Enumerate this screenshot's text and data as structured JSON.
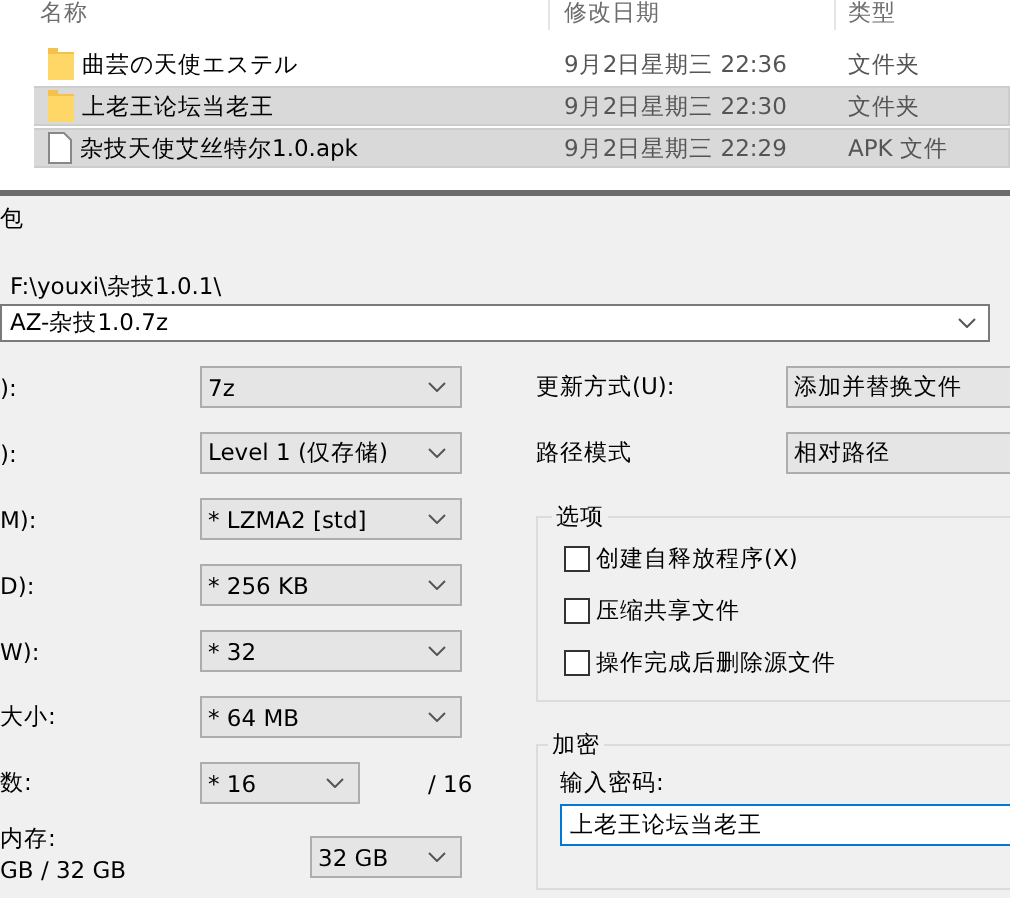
{
  "file_list": {
    "columns": [
      "名称",
      "修改日期",
      "类型"
    ],
    "rows": [
      {
        "kind": "folder",
        "name": "曲芸の天使エステル",
        "date": "9月2日星期三 22:36",
        "type": "文件夹",
        "selected": false
      },
      {
        "kind": "folder",
        "name": "上老王论坛当老王",
        "date": "9月2日星期三 22:30",
        "type": "文件夹",
        "selected": true
      },
      {
        "kind": "file",
        "name": "杂技天使艾丝特尔1.0.apk",
        "date": "9月2日星期三 22:29",
        "type": "APK 文件",
        "selected": true
      }
    ]
  },
  "dialog": {
    "title": "包",
    "archive_path": "F:\\youxi\\杂技1.0.1\\",
    "archive_name": "AZ-杂技1.0.7z",
    "settings": [
      {
        "kind": "select",
        "label": "):",
        "value": "7z"
      },
      {
        "kind": "select",
        "label": "):",
        "value": "Level 1 (仅存储)"
      },
      {
        "kind": "select",
        "label": "M):",
        "value": "* LZMA2 [std]"
      },
      {
        "kind": "select",
        "label": "D):",
        "value": "* 256 KB"
      },
      {
        "kind": "select",
        "label": "W):",
        "value": "* 32"
      },
      {
        "kind": "select",
        "label": "大小:",
        "value": "* 64 MB"
      },
      {
        "kind": "threads",
        "label": "数:",
        "value": "* 16",
        "suffix": "/ 16"
      },
      {
        "kind": "memory",
        "label": "内存:",
        "sublabel": "GB / 32 GB",
        "value": "32 GB"
      }
    ],
    "update_mode": {
      "label": "更新方式(U):",
      "value": "添加并替换文件"
    },
    "path_mode": {
      "label": "路径模式",
      "value": "相对路径"
    },
    "options": {
      "title": "选项",
      "items": [
        {
          "label": "创建自释放程序(X)",
          "checked": false
        },
        {
          "label": "压缩共享文件",
          "checked": false
        },
        {
          "label": "操作完成后删除源文件",
          "checked": false
        }
      ]
    },
    "encryption": {
      "title": "加密",
      "password_label": "输入密码:",
      "password": "上老王论坛当老王"
    }
  }
}
